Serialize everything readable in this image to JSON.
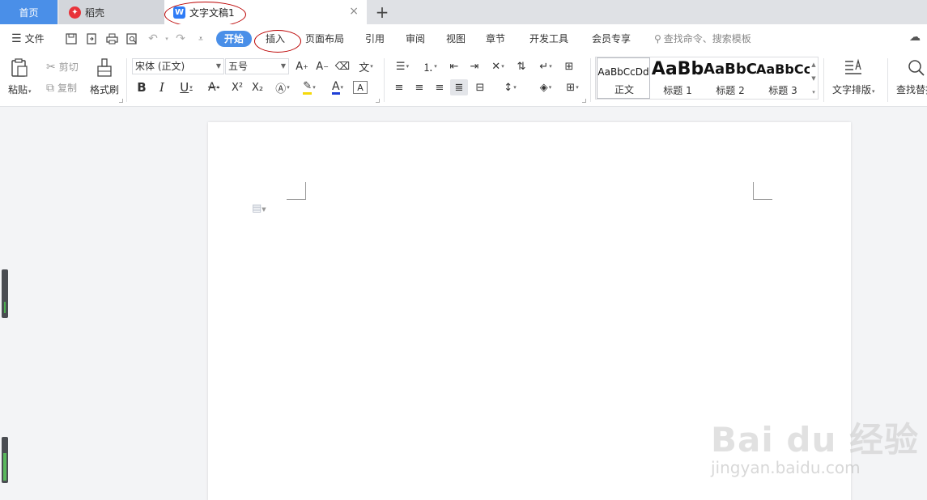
{
  "tabs": {
    "home": "首页",
    "docer": "稻壳",
    "doc": "文字文稿1",
    "close": "×",
    "add": "+"
  },
  "menu": {
    "file": "文件",
    "hamburger": "☰",
    "start": "开始",
    "insert": "插入",
    "layout": "页面布局",
    "reference": "引用",
    "review": "审阅",
    "view": "视图",
    "chapter": "章节",
    "devtools": "开发工具",
    "member": "会员专享",
    "search": "查找命令、搜索模板"
  },
  "ribbon": {
    "paste": "粘贴",
    "cut": "剪切",
    "copy": "复制",
    "format_painter": "格式刷",
    "font_name": "宋体 (正文)",
    "font_size": "五号",
    "styles": [
      {
        "preview": "AaBbCcDd",
        "label": "正文"
      },
      {
        "preview": "AaBb",
        "label": "标题 1"
      },
      {
        "preview": "AaBbC",
        "label": "标题 2"
      },
      {
        "preview": "AaBbCc",
        "label": "标题 3"
      }
    ],
    "text_layout": "文字排版",
    "find_replace": "查找替换"
  },
  "icons": {
    "save": "save-icon",
    "export_pdf": "export-pdf-icon",
    "print": "print-icon",
    "print_preview": "print-preview-icon",
    "undo": "undo-icon",
    "redo": "redo-icon",
    "cloud": "cloud-icon"
  },
  "colors": {
    "accent": "#4a8fe8",
    "highlight": "#f5d90a",
    "font_color": "#1f3fd6",
    "annotation": "#bb0000"
  },
  "watermark": {
    "logo": "Bai du 经验",
    "sub": "jingyan.baidu.com"
  }
}
